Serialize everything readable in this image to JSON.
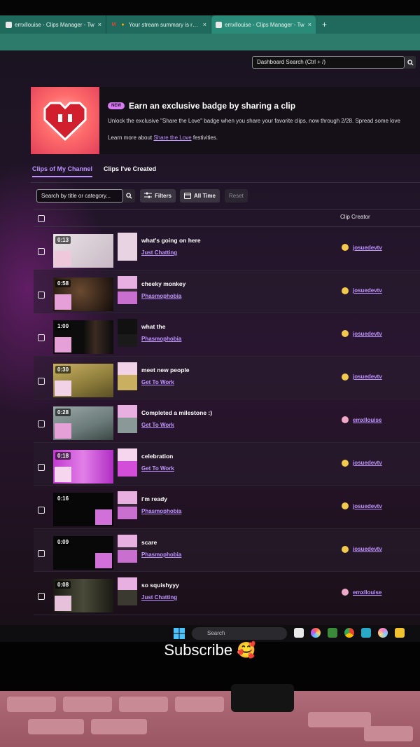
{
  "browser": {
    "tabs": [
      {
        "title": "emxllouise - Clips Manager - Tw",
        "icon": "twitch-icon",
        "active": false
      },
      {
        "title": "Your stream summary is ready",
        "icon": "gmail-icon",
        "active": false
      },
      {
        "title": "emxllouise - Clips Manager - Tw",
        "icon": "twitch-icon",
        "active": true
      }
    ],
    "close_glyph": "×",
    "new_tab_glyph": "+"
  },
  "header": {
    "dashboard_search_placeholder": "Dashboard Search (Ctrl + /)"
  },
  "banner": {
    "new_label": "NEW",
    "title": "Earn an exclusive badge by sharing a clip",
    "description": "Unlock the exclusive \"Share the Love\" badge when you share your favorite clips, now through 2/28. Spread some love",
    "learn_more_prefix": "Learn more about ",
    "learn_more_link": "Share the Love",
    "learn_more_suffix": " festivities."
  },
  "clip_tabs": [
    {
      "label": "Clips of My Channel",
      "active": true
    },
    {
      "label": "Clips I've Created",
      "active": false
    }
  ],
  "filters": {
    "search_placeholder": "Search by title or category...",
    "filters_label": "Filters",
    "time_label": "All Time",
    "reset_label": "Reset"
  },
  "table": {
    "creator_header": "Clip Creator",
    "rows": [
      {
        "duration": "0:13",
        "title": "what's going on here",
        "category": "Just Chatting",
        "creator": "josuedevtv"
      },
      {
        "duration": "0:58",
        "title": "cheeky monkey",
        "category": "Phasmophobia",
        "creator": "josuedevtv"
      },
      {
        "duration": "1:00",
        "title": "what the",
        "category": "Phasmophobia",
        "creator": "josuedevtv"
      },
      {
        "duration": "0:30",
        "title": "meet new people",
        "category": "Get To Work",
        "creator": "josuedevtv"
      },
      {
        "duration": "0:28",
        "title": "Completed a milestone :)",
        "category": "Get To Work",
        "creator": "emxllouise"
      },
      {
        "duration": "0:18",
        "title": "celebration",
        "category": "Get To Work",
        "creator": "josuedevtv"
      },
      {
        "duration": "0:16",
        "title": "i'm ready",
        "category": "Phasmophobia",
        "creator": "josuedevtv"
      },
      {
        "duration": "0:09",
        "title": "scare",
        "category": "Phasmophobia",
        "creator": "josuedevtv"
      },
      {
        "duration": "0:08",
        "title": "so squishyyy",
        "category": "Just Chatting",
        "creator": "emxllouise"
      }
    ]
  },
  "taskbar": {
    "search_placeholder": "Search"
  },
  "caption": "Subscribe 🥰",
  "colors": {
    "accent": "#bf94ff",
    "tabstrip": "#1f6a5c"
  }
}
